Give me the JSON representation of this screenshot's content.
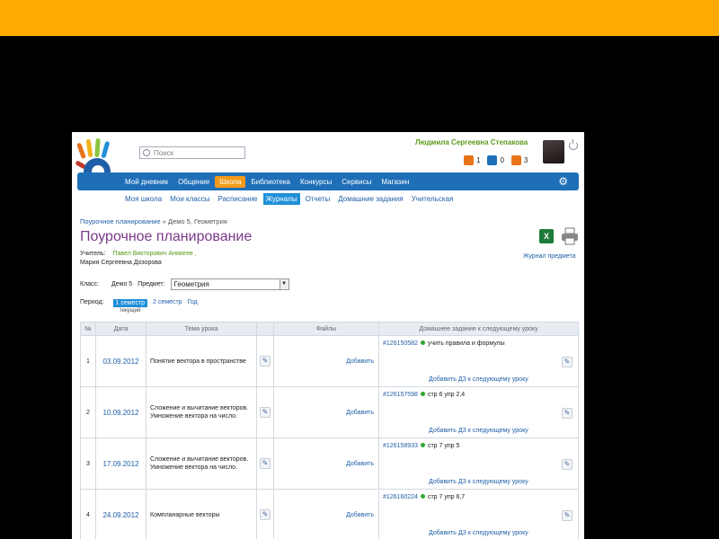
{
  "header": {
    "search_placeholder": "Поиск",
    "user_name": "Людмила Сергеевна Степакова",
    "counters": [
      {
        "icon": "mail-icon",
        "value": "1",
        "color": "#e8731a"
      },
      {
        "icon": "people-icon",
        "value": "0",
        "color": "#1f6fb8"
      },
      {
        "icon": "puzzle-icon",
        "value": "3",
        "color": "#e8731a"
      }
    ]
  },
  "mainnav": {
    "items": [
      "Мой дневник",
      "Общение",
      "Школа",
      "Библиотека",
      "Конкурсы",
      "Сервисы",
      "Магазин"
    ],
    "active": "Школа"
  },
  "subnav": {
    "items": [
      "Моя школа",
      "Мои классы",
      "Расписание",
      "Журналы",
      "Отчеты",
      "Домашние задания",
      "Учительская"
    ],
    "active": "Журналы"
  },
  "breadcrumb": {
    "link": "Поурочное планирование",
    "sep": "»",
    "current": "Демо 5, Геометрия"
  },
  "page_title": "Поурочное планирование",
  "teacher": {
    "label": "Учитель:",
    "name": "Павел Викторович Аникеев ,",
    "name2": "Мария Сергеевна Дозорова"
  },
  "journal_link": "Журнал предмета",
  "filters": {
    "class_label": "Класс:",
    "class_value": "Демо 5",
    "subject_label": "Предмет:",
    "subject_value": "Геометрия"
  },
  "period": {
    "label": "Период:",
    "active": "1 семестр",
    "current_note": "текущий",
    "items": [
      "2 семестр",
      "Год"
    ]
  },
  "table": {
    "headers": [
      "№",
      "Дата",
      "Тема урока",
      "",
      "Файлы",
      "Домашнее задание к следующему уроку"
    ],
    "rows": [
      {
        "num": "1",
        "date": "03.09.2012",
        "topic": "Понятие вектора в пространстве",
        "files": "Добавить",
        "hw_id": "#126150582",
        "hw_text": "учить правила и формулы",
        "hw_add": "Добавить ДЗ к следующему уроку"
      },
      {
        "num": "2",
        "date": "10.09.2012",
        "topic": "Сложение и вычитание векторов. Умножение вектора на число.",
        "files": "Добавить",
        "hw_id": "#126157598",
        "hw_text": "стр 6 упр 2,4",
        "hw_add": "Добавить ДЗ к следующему уроку"
      },
      {
        "num": "3",
        "date": "17.09.2012",
        "topic": "Сложение и вычитание векторов. Умножение вектора на число.",
        "files": "Добавить",
        "hw_id": "#126158933",
        "hw_text": "стр 7 упр 5",
        "hw_add": "Добавить ДЗ к следующему уроку"
      },
      {
        "num": "4",
        "date": "24.09.2012",
        "topic": "Компланарные векторы",
        "files": "Добавить",
        "hw_id": "#126160224",
        "hw_text": "стр 7 упр 6,7",
        "hw_add": "Добавить ДЗ к следующему уроку"
      }
    ]
  }
}
